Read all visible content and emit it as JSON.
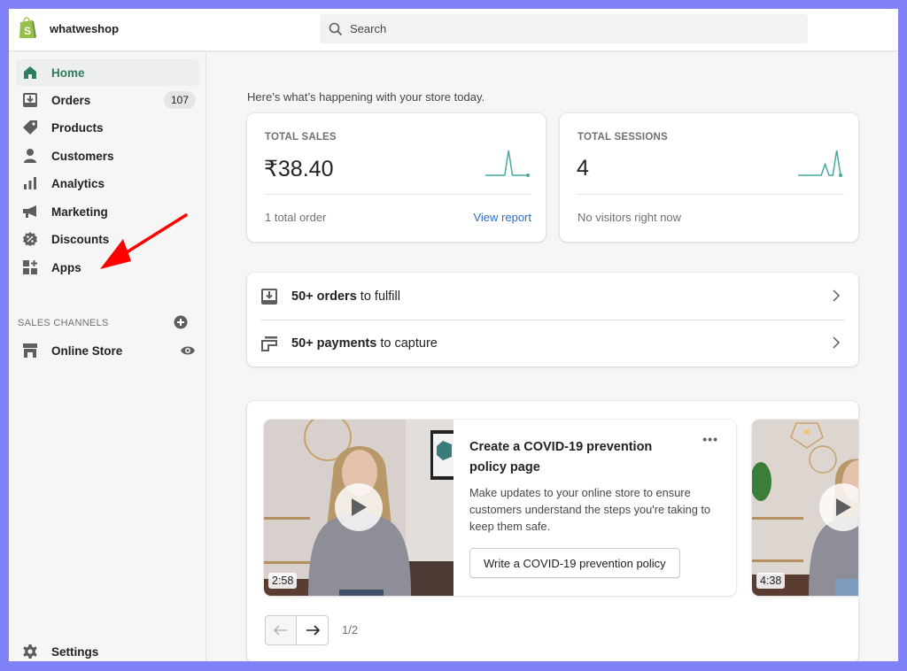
{
  "topbar": {
    "shop_name": "whatweshop",
    "search_placeholder": "Search",
    "logo_icon": "shopify-bag-icon"
  },
  "sidebar": {
    "items": [
      {
        "label": "Home",
        "icon": "home-icon",
        "active": true
      },
      {
        "label": "Orders",
        "icon": "orders-icon",
        "badge": "107"
      },
      {
        "label": "Products",
        "icon": "tag-icon"
      },
      {
        "label": "Customers",
        "icon": "person-icon"
      },
      {
        "label": "Analytics",
        "icon": "bar-chart-icon"
      },
      {
        "label": "Marketing",
        "icon": "megaphone-icon"
      },
      {
        "label": "Discounts",
        "icon": "discount-icon"
      },
      {
        "label": "Apps",
        "icon": "apps-icon"
      }
    ],
    "sales_channels_label": "SALES CHANNELS",
    "channels": [
      {
        "label": "Online Store",
        "icon": "store-icon",
        "action_icon": "eye-icon"
      }
    ],
    "settings_label": "Settings"
  },
  "main": {
    "intro": "Here’s what’s happening with your store today.",
    "metrics": [
      {
        "title": "TOTAL SALES",
        "value": "₹38.40",
        "footer": "1 total order",
        "link": "View report",
        "sparkline": [
          0,
          0,
          0,
          0,
          0,
          0,
          1,
          0,
          0,
          0,
          0,
          0
        ]
      },
      {
        "title": "TOTAL SESSIONS",
        "value": "4",
        "footer": "No visitors right now",
        "sparkline": [
          0,
          0,
          0,
          0,
          0,
          0,
          0,
          0.45,
          0,
          0,
          1,
          0
        ]
      }
    ],
    "tasks": [
      {
        "bold": "50+ orders",
        "rest": " to fulfill",
        "icon": "orders-icon"
      },
      {
        "bold": "50+ payments",
        "rest": " to capture",
        "icon": "payment-icon"
      }
    ],
    "video_cards": [
      {
        "title": "Create a COVID-19 prevention policy page",
        "description": "Make updates to your online store to ensure customers understand the steps you're taking to keep them safe.",
        "button": "Write a COVID-19 prevention policy",
        "duration": "2:58",
        "more": "•••"
      },
      {
        "duration": "4:38"
      }
    ],
    "pager": {
      "text": "1/2"
    }
  },
  "colors": {
    "accent_green": "#2e7d5b",
    "link_blue": "#2c6ecb",
    "sparkline": "#47a9a1",
    "frame": "#8080f8",
    "annotation_arrow": "#ff0000"
  }
}
